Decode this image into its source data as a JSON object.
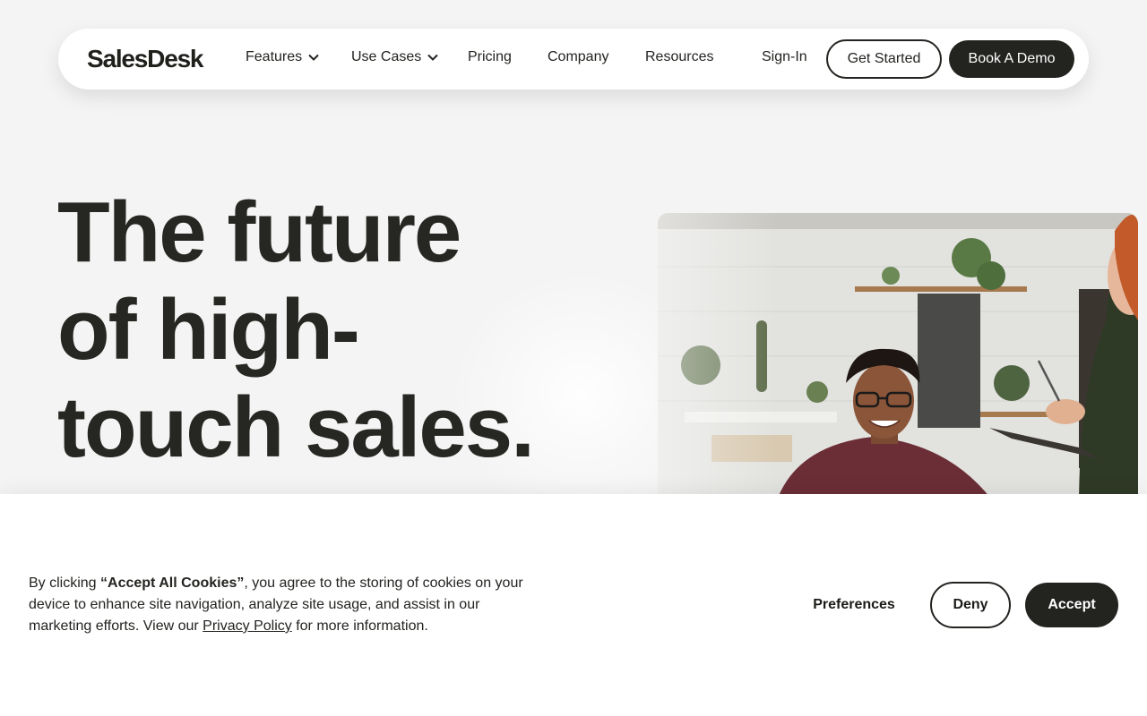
{
  "nav": {
    "logo": "SalesDesk",
    "links": [
      {
        "label": "Features",
        "has_dropdown": true
      },
      {
        "label": "Use Cases",
        "has_dropdown": true
      },
      {
        "label": "Pricing",
        "has_dropdown": false
      },
      {
        "label": "Company",
        "has_dropdown": false
      },
      {
        "label": "Resources",
        "has_dropdown": false
      }
    ],
    "sign_in": "Sign-In",
    "get_started": "Get Started",
    "book_demo": "Book A Demo"
  },
  "hero": {
    "title_line1": "The future",
    "title_line2": "of high-",
    "title_line3": "touch sales.",
    "image_alt": "Smiling man with glasses in a meeting with a colleague holding a tablet"
  },
  "cookie": {
    "text_prefix": "By clicking ",
    "text_bold": "“Accept All Cookies”",
    "text_middle": ", you agree to the storing of cookies on your device to enhance site navigation, analyze site usage, and assist in our marketing efforts. View our ",
    "privacy_link": "Privacy Policy",
    "text_suffix": " for more information.",
    "preferences": "Preferences",
    "deny": "Deny",
    "accept": "Accept"
  },
  "colors": {
    "background": "#f4f4f4",
    "dark": "#232320",
    "white": "#ffffff"
  }
}
